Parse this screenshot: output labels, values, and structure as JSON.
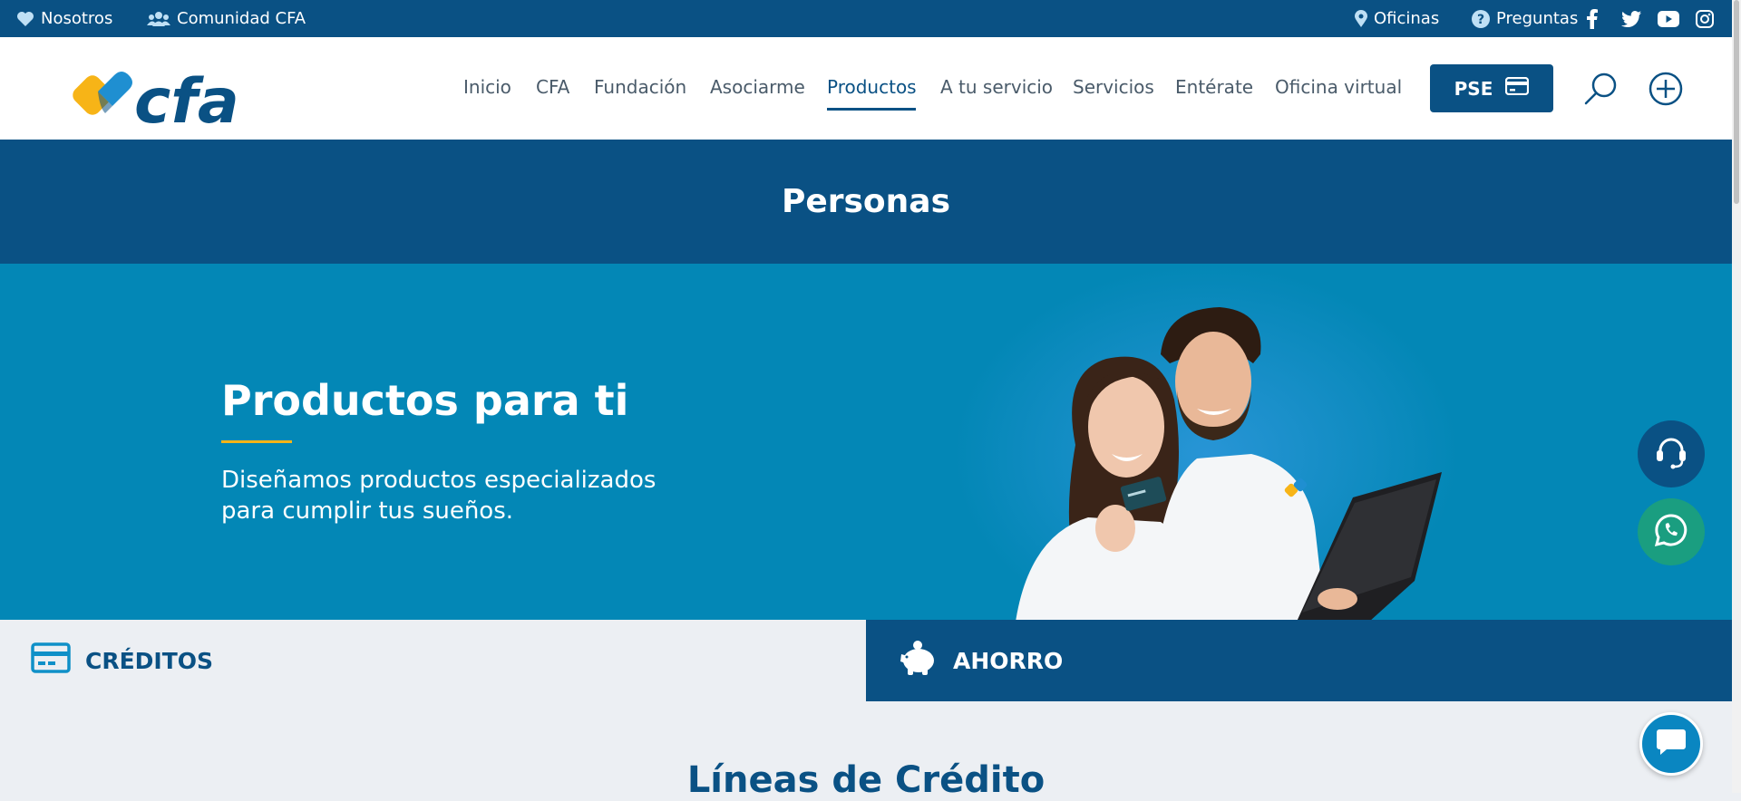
{
  "topbar": {
    "nosotros": "Nosotros",
    "comunidad": "Comunidad CFA",
    "oficinas": "Oficinas",
    "preguntas": "Preguntas",
    "social": [
      "facebook-icon",
      "twitter-icon",
      "youtube-icon",
      "instagram-icon"
    ]
  },
  "header": {
    "logo_text": "cfa",
    "nav": [
      "Inicio",
      "CFA",
      "Fundación",
      "Asociarme",
      "Productos",
      "A tu servicio",
      "Servicios",
      "Entérate",
      "Oficina virtual"
    ],
    "active_nav": "Productos",
    "pse_label": "PSE"
  },
  "section_title": "Personas",
  "hero": {
    "title": "Productos para ti",
    "subtitle": "Diseñamos productos especializados para cumplir tus sueños."
  },
  "tabs": {
    "creditos": "CRÉDITOS",
    "ahorro": "AHORRO"
  },
  "lines_title": "Líneas de Crédito",
  "colors": {
    "primary": "#0a5184",
    "hero_bg": "#0387b6",
    "accent_yellow": "#f7b417",
    "whatsapp": "#1a9e80"
  }
}
